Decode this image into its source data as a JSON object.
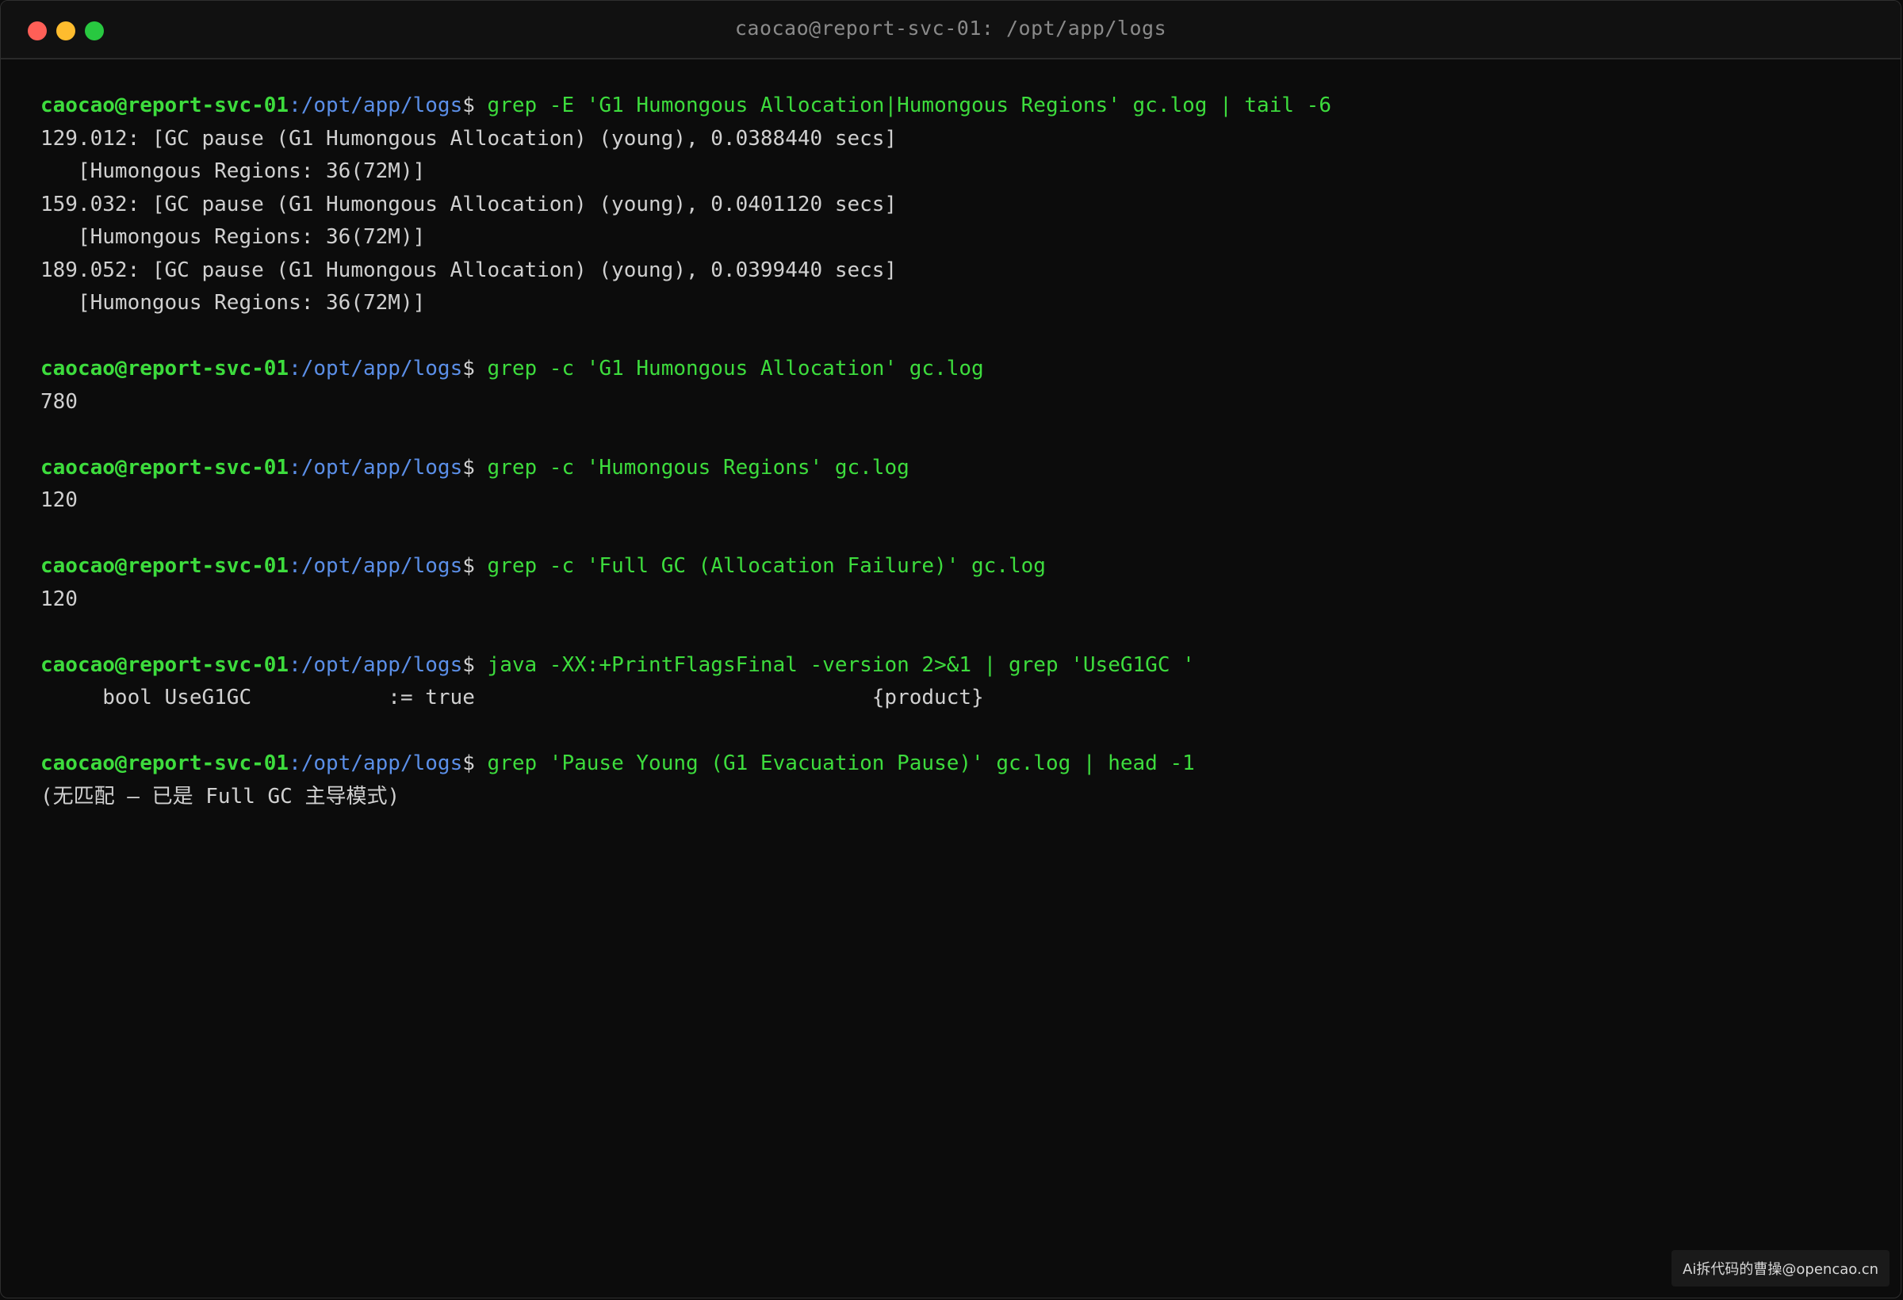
{
  "window": {
    "title": "caocao@report-svc-01: /opt/app/logs"
  },
  "prompt": {
    "user_host": "caocao@report-svc-01",
    "path": ":/opt/app/logs",
    "symbol": "$"
  },
  "blocks": [
    {
      "command": " grep -E 'G1 Humongous Allocation|Humongous Regions' gc.log | tail -6",
      "output": [
        "129.012: [GC pause (G1 Humongous Allocation) (young), 0.0388440 secs]",
        "   [Humongous Regions: 36(72M)]",
        "159.032: [GC pause (G1 Humongous Allocation) (young), 0.0401120 secs]",
        "   [Humongous Regions: 36(72M)]",
        "189.052: [GC pause (G1 Humongous Allocation) (young), 0.0399440 secs]",
        "   [Humongous Regions: 36(72M)]"
      ]
    },
    {
      "command": " grep -c 'G1 Humongous Allocation' gc.log",
      "output": [
        "780"
      ]
    },
    {
      "command": " grep -c 'Humongous Regions' gc.log",
      "output": [
        "120"
      ]
    },
    {
      "command": " grep -c 'Full GC (Allocation Failure)' gc.log",
      "output": [
        "120"
      ]
    },
    {
      "command": " java -XX:+PrintFlagsFinal -version 2>&1 | grep 'UseG1GC '",
      "output": [
        "     bool UseG1GC           := true                                {product}"
      ]
    },
    {
      "command": " grep 'Pause Young (G1 Evacuation Pause)' gc.log | head -1",
      "output": [
        "(无匹配 — 已是 Full GC 主导模式)"
      ]
    }
  ],
  "watermark": "Ai拆代码的曹操@opencao.cn",
  "colors": {
    "background": "#0c0c0c",
    "prompt_user": "#3ddc3d",
    "prompt_path": "#5b8fe8",
    "command": "#3ddc3d",
    "output": "#d0d0d0"
  }
}
